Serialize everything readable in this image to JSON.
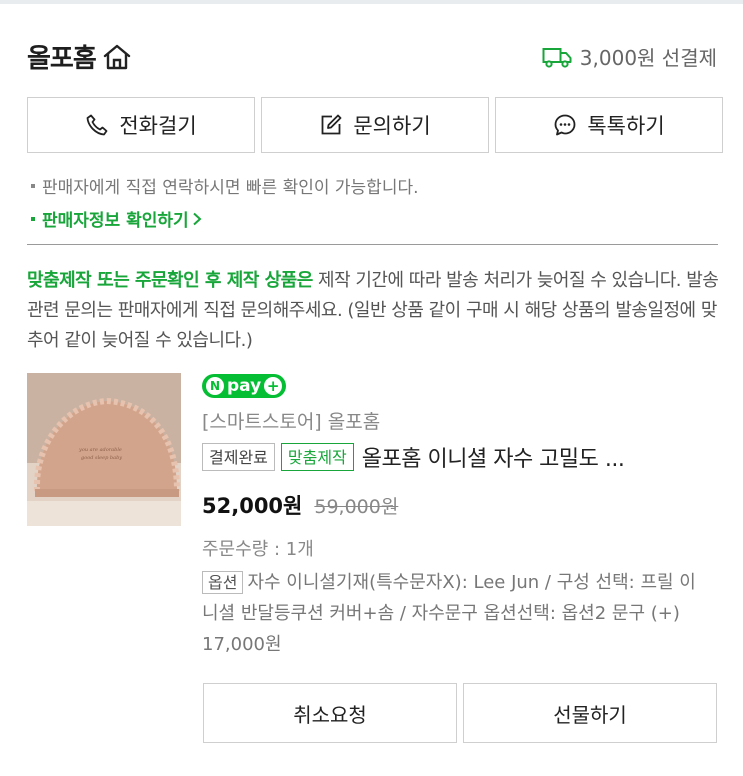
{
  "header": {
    "store_title": "올포홈",
    "shipping_text": "3,000원 선결제"
  },
  "contact_buttons": [
    {
      "label": "전화걸기",
      "icon": "phone-icon"
    },
    {
      "label": "문의하기",
      "icon": "edit-icon"
    },
    {
      "label": "톡톡하기",
      "icon": "chat-icon"
    }
  ],
  "notes": {
    "contact_note": "판매자에게 직접 연락하시면 빠른 확인이 가능합니다.",
    "seller_info_link": "판매자정보 확인하기"
  },
  "notice": {
    "highlight": "맞춤제작 또는 주문확인 후 제작 상품은",
    "text": " 제작 기간에 따라 발송 처리가 늦어질 수 있습니다. 발송 관련 문의는 판매자에게 직접 문의해주세요. (일반 상품 같이 구매 시 해당 상품의 발송일정에 맞추어 같이 늦어질 수 있습니다.)"
  },
  "product": {
    "npay_text": "pay",
    "store_name": "[스마트스토어] 올포홈",
    "status_tag": "결제완료",
    "custom_tag": "맞춤제작",
    "title": "올포홈 이니셜 자수 고밀도 ...",
    "price": "52,000원",
    "original_price": "59,000원",
    "quantity": "주문수량 : 1개",
    "option_tag": "옵션",
    "option_text": "자수 이니셜기재(특수문자X): Lee Jun / 구성 선택: 프릴 이니셜 반달등쿠션 커버+솜 / 자수문구 옵션선택: 옵션2 문구 (+) 17,000원"
  },
  "action_buttons": {
    "cancel": "취소요청",
    "gift": "선물하기"
  },
  "colors": {
    "accent_green": "#18a63a",
    "npay_green": "#06be34"
  }
}
